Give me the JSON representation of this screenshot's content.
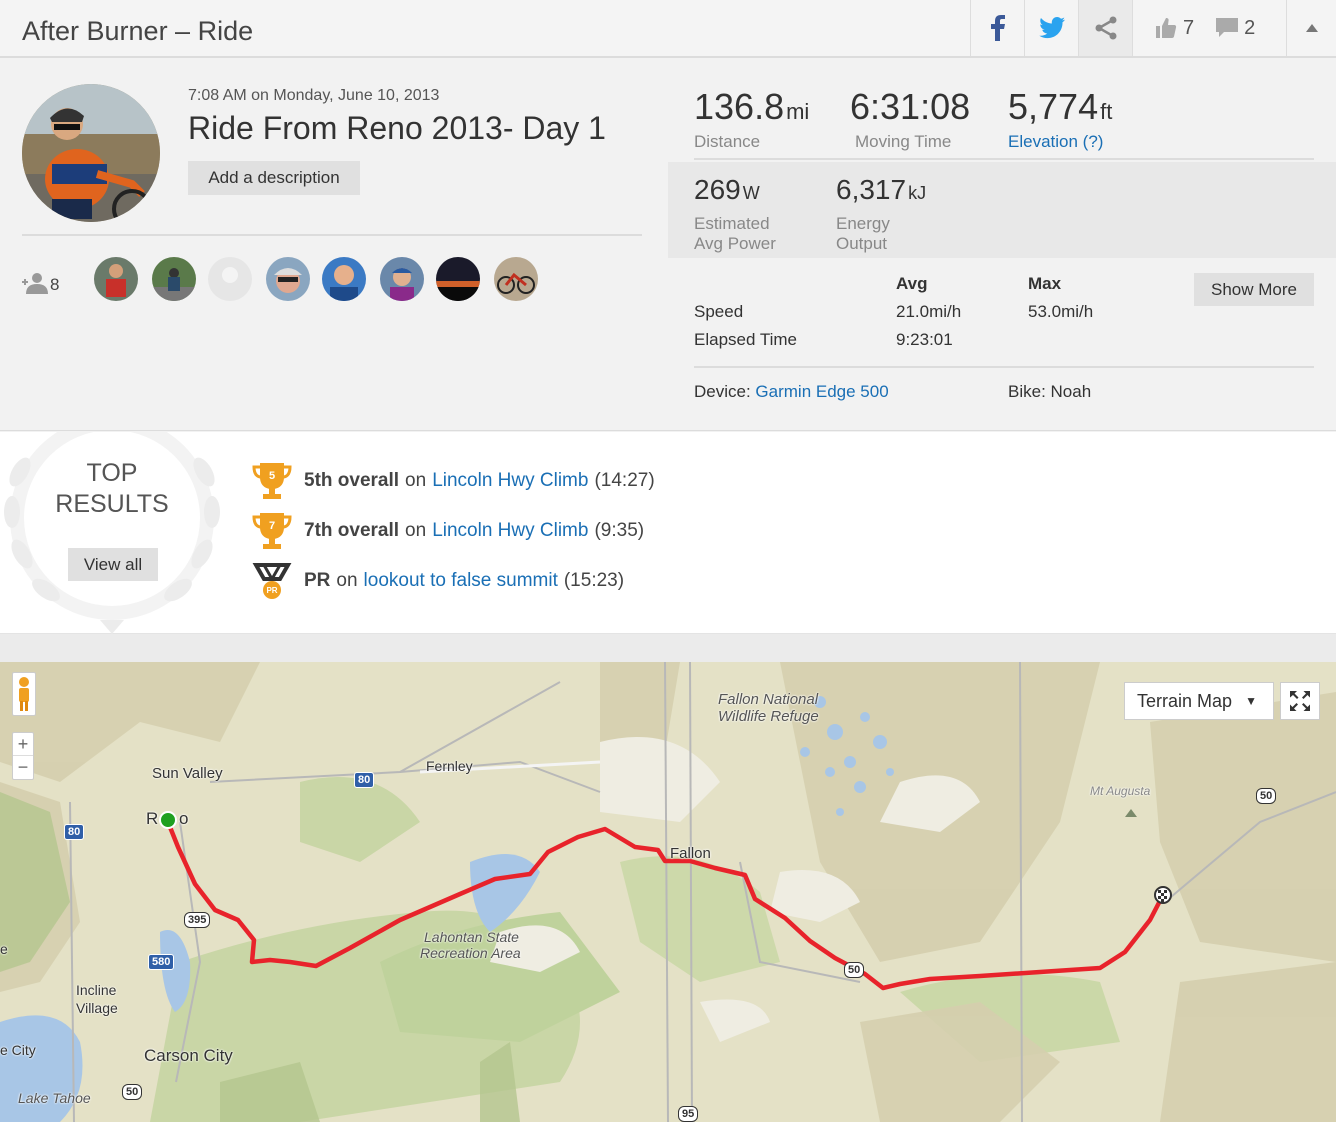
{
  "header": {
    "title": "After Burner – Ride",
    "kudos_count": "7",
    "comments_count": "2"
  },
  "activity": {
    "date": "7:08 AM on Monday, June 10, 2013",
    "name": "Ride From Reno 2013- Day 1",
    "add_description": "Add a description",
    "athletes_count": "8"
  },
  "stats": {
    "distance": {
      "value": "136.8",
      "unit": "mi",
      "label": "Distance"
    },
    "moving_time": {
      "value": "6:31:08",
      "label": "Moving Time"
    },
    "elevation": {
      "value": "5,774",
      "unit": "ft",
      "label": "Elevation (?)"
    },
    "power": {
      "value": "269",
      "unit": "W",
      "label_1": "Estimated",
      "label_2": "Avg Power"
    },
    "energy": {
      "value": "6,317",
      "unit": "kJ",
      "label_1": "Energy",
      "label_2": "Output"
    }
  },
  "table": {
    "col_avg": "Avg",
    "col_max": "Max",
    "show_more": "Show More",
    "rows": [
      {
        "label": "Speed",
        "avg": "21.0mi/h",
        "max": "53.0mi/h"
      },
      {
        "label": "Elapsed Time",
        "avg": "9:23:01",
        "max": ""
      }
    ]
  },
  "device": {
    "device_label": "Device:",
    "device_name": "Garmin Edge 500",
    "bike_label": "Bike:",
    "bike_name": "Noah"
  },
  "top_results": {
    "title_1": "TOP",
    "title_2": "RESULTS",
    "view_all": "View all",
    "items": [
      {
        "rank": "5th overall",
        "on": "on",
        "segment": "Lincoln Hwy Climb",
        "time": "(14:27)",
        "badge": "5",
        "icon": "trophy-icon"
      },
      {
        "rank": "7th overall",
        "on": "on",
        "segment": "Lincoln Hwy Climb",
        "time": "(9:35)",
        "badge": "7",
        "icon": "trophy-icon"
      },
      {
        "rank": "PR",
        "on": "on",
        "segment": "lookout to false summit",
        "time": "(15:23)",
        "badge": "PR",
        "icon": "pr-medal-icon"
      }
    ]
  },
  "map": {
    "map_type": "Terrain Map",
    "labels": {
      "sun_valley": "Sun Valley",
      "reno_r": "R",
      "reno_o": "o",
      "fernley": "Fernley",
      "fallon": "Fallon",
      "fallon_refuge_1": "Fallon National",
      "fallon_refuge_2": "Wildlife Refuge",
      "lahontan_1": "Lahontan State",
      "lahontan_2": "Recreation Area",
      "incline_1": "Incline",
      "incline_2": "Village",
      "carson_city": "Carson City",
      "lake_tahoe": "Lake Tahoe",
      "e_city": "e City",
      "e": "e",
      "mt_augusta": "Mt Augusta"
    },
    "highways": {
      "i80_a": "80",
      "i80_b": "80",
      "us395": "395",
      "i580": "580",
      "us50_a": "50",
      "us50_b": "50",
      "us50_c": "50",
      "us95": "95"
    },
    "colors": {
      "route": "#e8232b",
      "start": "#1fa020"
    }
  }
}
